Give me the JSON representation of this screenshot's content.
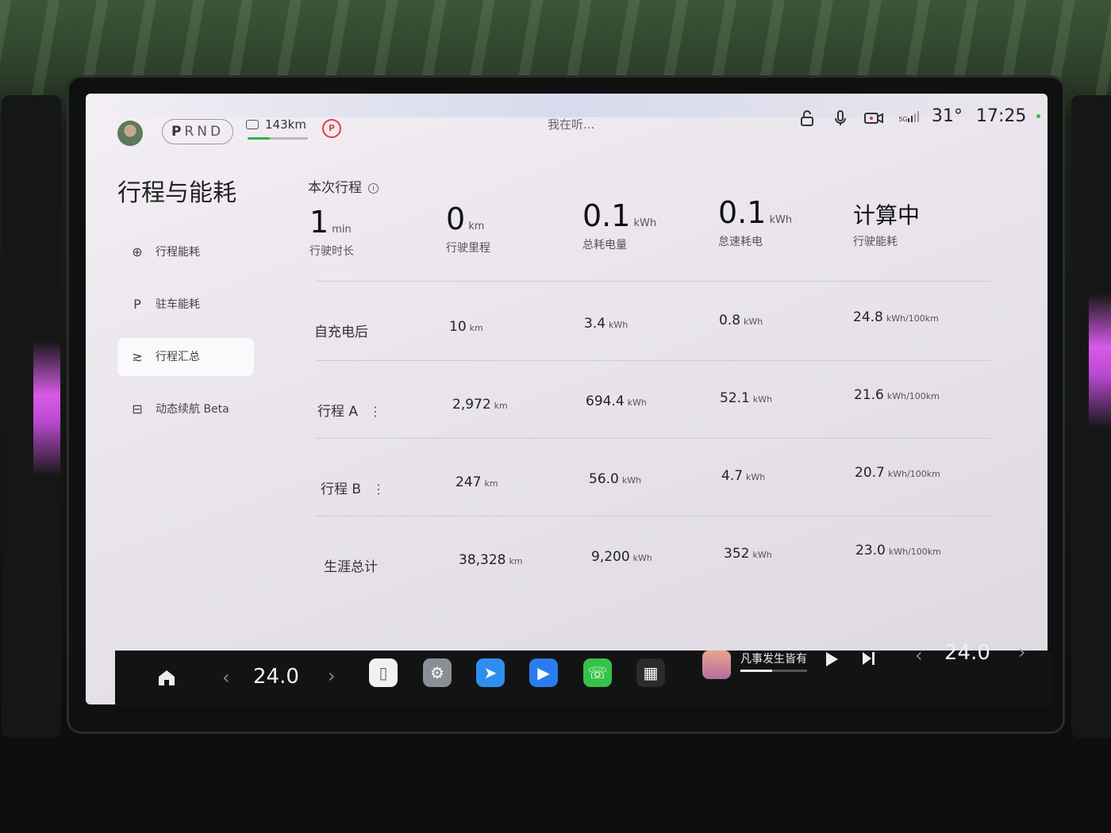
{
  "status_bar": {
    "gears": [
      "P",
      "R",
      "N",
      "D"
    ],
    "range": "143km",
    "range_progress": 0.37,
    "voice_text": "我在听...",
    "signal": "5G",
    "temperature": "31°",
    "time": "17:25",
    "icons": [
      "avatar",
      "car-icon",
      "parking-brake-icon",
      "unlock-icon",
      "microphone-icon",
      "camera-icon",
      "signal-icon"
    ]
  },
  "sidebar": {
    "title": "行程与能耗",
    "items": [
      {
        "icon": "steering-wheel-icon",
        "glyph": "⊕",
        "label": "行程能耗",
        "active": false
      },
      {
        "icon": "parking-icon",
        "glyph": "P",
        "label": "驻车能耗",
        "active": false
      },
      {
        "icon": "summary-icon",
        "glyph": "≳",
        "label": "行程汇总",
        "active": true
      },
      {
        "icon": "car-range-icon",
        "glyph": "⊟",
        "label": "动态续航 Beta",
        "active": false
      }
    ]
  },
  "current_trip": {
    "title": "本次行程",
    "info_glyph": "i",
    "stats": [
      {
        "value": "1",
        "unit": "min",
        "label": "行驶时长"
      },
      {
        "value": "0",
        "unit": "km",
        "label": "行驶里程"
      },
      {
        "value": "0.1",
        "unit": "kWh",
        "label": "总耗电量"
      },
      {
        "value": "0.1",
        "unit": "kWh",
        "label": "怠速耗电"
      },
      {
        "value": "计算中",
        "unit": "",
        "label": "行驶能耗"
      }
    ]
  },
  "summary_rows": [
    {
      "label": "自充电后",
      "menu": false,
      "distance": "10",
      "distance_unit": "km",
      "energy": "3.4",
      "energy_unit": "kWh",
      "idle": "0.8",
      "idle_unit": "kWh",
      "consumption": "24.8",
      "consumption_unit": "kWh/100km"
    },
    {
      "label": "行程 A",
      "menu": true,
      "distance": "2,972",
      "distance_unit": "km",
      "energy": "694.4",
      "energy_unit": "kWh",
      "idle": "52.1",
      "idle_unit": "kWh",
      "consumption": "21.6",
      "consumption_unit": "kWh/100km"
    },
    {
      "label": "行程 B",
      "menu": true,
      "distance": "247",
      "distance_unit": "km",
      "energy": "56.0",
      "energy_unit": "kWh",
      "idle": "4.7",
      "idle_unit": "kWh",
      "consumption": "20.7",
      "consumption_unit": "kWh/100km"
    },
    {
      "label": "生涯总计",
      "menu": false,
      "distance": "38,328",
      "distance_unit": "km",
      "energy": "9,200",
      "energy_unit": "kWh",
      "idle": "352",
      "idle_unit": "kWh",
      "consumption": "23.0",
      "consumption_unit": "kWh/100km"
    }
  ],
  "dock": {
    "left_temp": "24.0",
    "right_temp": "24.0",
    "media_title": "凡事发生皆有",
    "media_progress": 0.48,
    "apps": [
      {
        "icon": "phone-mirror-icon",
        "color": "#f2f2f2"
      },
      {
        "icon": "settings-icon",
        "color": "#8a8f96"
      },
      {
        "icon": "navigation-icon",
        "color": "#2f8ff0"
      },
      {
        "icon": "video-call-icon",
        "color": "#2a7cf0"
      },
      {
        "icon": "phone-icon",
        "color": "#36c24a"
      },
      {
        "icon": "app-grid-icon",
        "color": "#2b2b2b"
      }
    ]
  }
}
